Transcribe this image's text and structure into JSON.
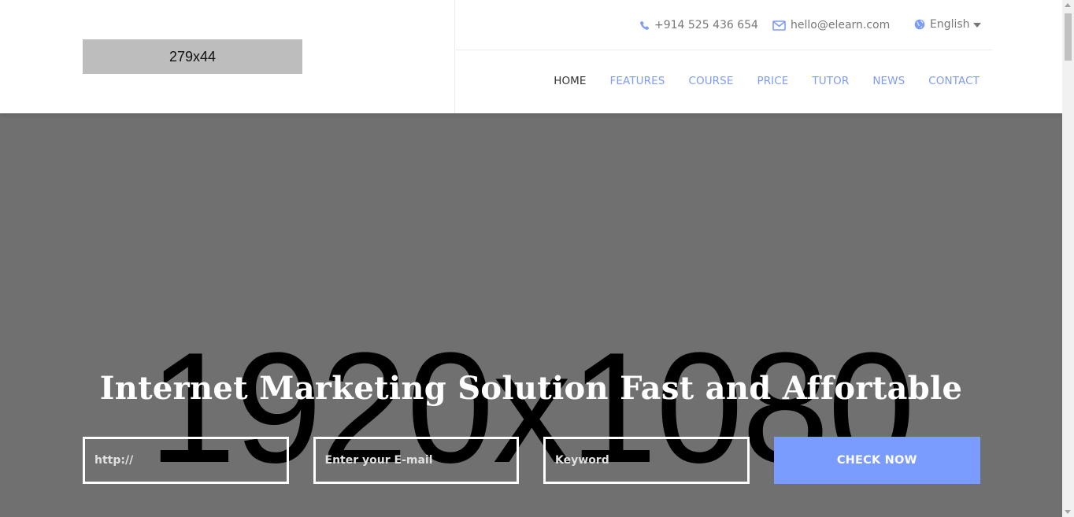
{
  "header": {
    "logo_placeholder": "279x44",
    "contacts": {
      "phone": "+914 525 436 654",
      "email": "hello@elearn.com",
      "language": "English"
    },
    "nav": [
      {
        "label": "HOME",
        "active": true
      },
      {
        "label": "FEATURES",
        "active": false
      },
      {
        "label": "COURSE",
        "active": false
      },
      {
        "label": "PRICE",
        "active": false
      },
      {
        "label": "TUTOR",
        "active": false
      },
      {
        "label": "NEWS",
        "active": false
      },
      {
        "label": "CONTACT",
        "active": false
      }
    ]
  },
  "hero": {
    "background_placeholder": "1920x1080",
    "title": "Internet Marketing Solution Fast and Affortable",
    "form": {
      "url_placeholder": "http://",
      "email_placeholder": "Enter your E-mail",
      "keyword_placeholder": "Keyword",
      "submit_label": "CHECK NOW"
    }
  },
  "colors": {
    "accent": "#7b9cff",
    "nav_link": "#7f9cf5",
    "hero_bg": "#707070",
    "logo_placeholder_bg": "#bdbdbd"
  },
  "icons": [
    "phone-icon",
    "mail-icon",
    "globe-icon",
    "caret-down-icon"
  ]
}
